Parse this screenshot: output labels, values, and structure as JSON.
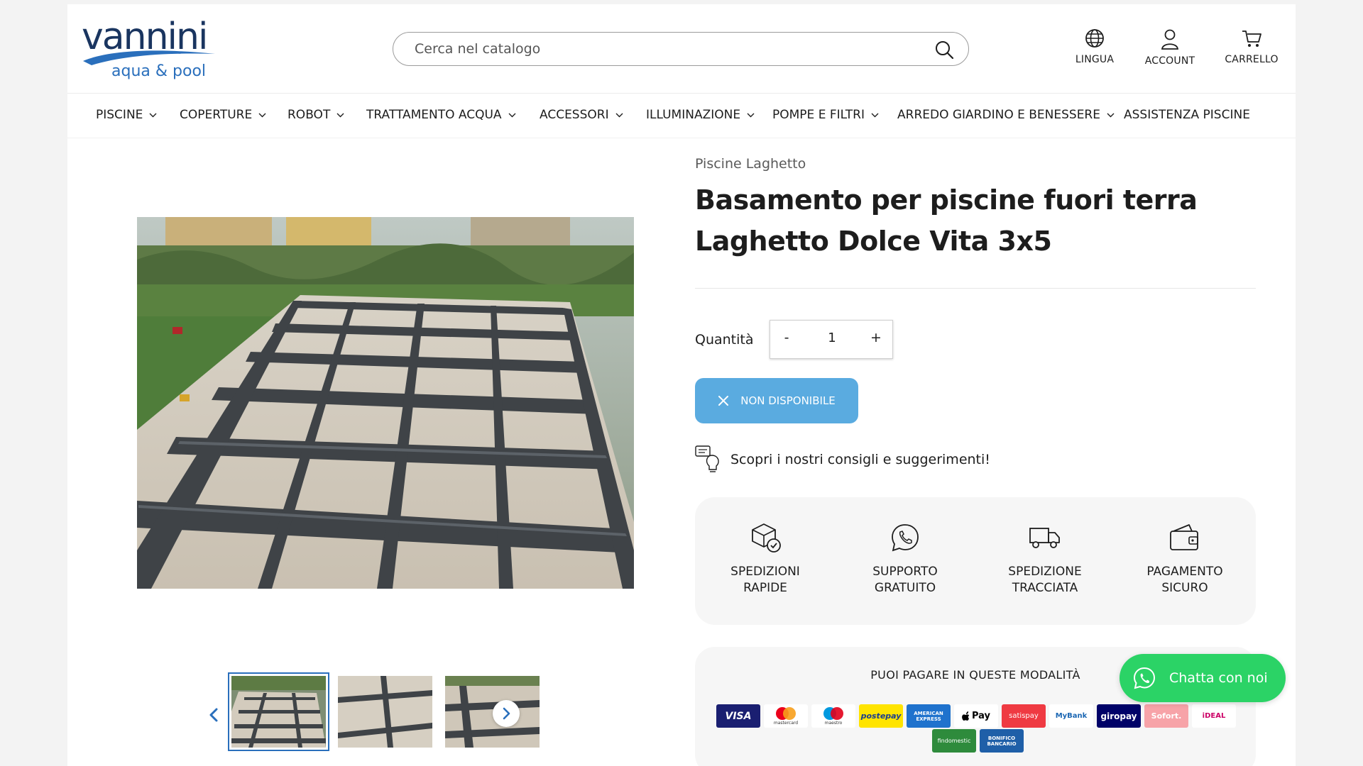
{
  "brand": {
    "name": "vannini",
    "tagline": "aqua & pool"
  },
  "search": {
    "placeholder": "Cerca nel catalogo"
  },
  "header_actions": [
    {
      "label": "LINGUA",
      "icon": "globe-icon"
    },
    {
      "label": "ACCOUNT",
      "icon": "user-icon"
    },
    {
      "label": "CARRELLO",
      "icon": "cart-icon"
    }
  ],
  "nav": [
    {
      "label": "PISCINE",
      "dropdown": true
    },
    {
      "label": "COPERTURE",
      "dropdown": true
    },
    {
      "label": "ROBOT",
      "dropdown": true
    },
    {
      "label": "TRATTAMENTO ACQUA",
      "dropdown": true
    },
    {
      "label": "ACCESSORI",
      "dropdown": true
    },
    {
      "label": "ILLUMINAZIONE",
      "dropdown": true
    },
    {
      "label": "POMPE E FILTRI",
      "dropdown": true
    },
    {
      "label": "ARREDO GIARDINO E BENESSERE",
      "dropdown": true
    },
    {
      "label": "ASSISTENZA PISCINE",
      "dropdown": false
    }
  ],
  "product": {
    "vendor": "Piscine Laghetto",
    "title": "Basamento per piscine fuori terra Laghetto Dolce Vita 3x5",
    "quantity_label": "Quantità",
    "quantity_minus": "-",
    "quantity_value": "1",
    "quantity_plus": "+",
    "availability_label": "NON DISPONIBILE",
    "tips_text": "Scopri i nostri consigli e suggerimenti!"
  },
  "features": [
    {
      "line1": "SPEDIZIONI",
      "line2": "RAPIDE",
      "icon": "box-check-icon"
    },
    {
      "line1": "SUPPORTO",
      "line2": "GRATUITO",
      "icon": "whatsapp-icon"
    },
    {
      "line1": "SPEDIZIONE",
      "line2": "TRACCIATA",
      "icon": "truck-icon"
    },
    {
      "line1": "PAGAMENTO",
      "line2": "SICURO",
      "icon": "wallet-icon"
    }
  ],
  "payments": {
    "title": "PUOI PAGARE IN QUESTE MODALITÀ",
    "methods": [
      "VISA",
      "mastercard",
      "maestro",
      "postepay",
      "AMERICAN EXPRESS",
      "Pay",
      "satispay",
      "MyBank",
      "giropay",
      "Sofort.",
      "iDEAL",
      "findomestic",
      "BONIFICO BANCARIO"
    ]
  },
  "chat": {
    "label": "Chatta con noi"
  },
  "colors": {
    "accent": "#5aabe0",
    "brand_dark": "#1a3560",
    "brand_blue": "#2a6fbc",
    "chat_green": "#2bd366"
  }
}
